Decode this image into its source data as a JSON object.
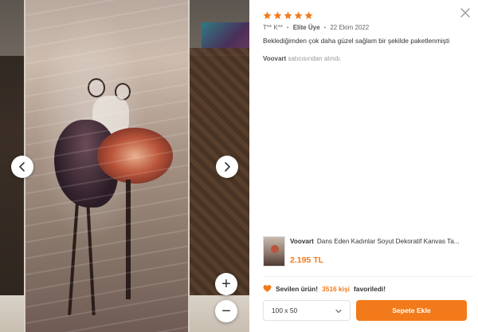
{
  "viewer": {
    "prev_icon": "chevron-left-icon",
    "next_icon": "chevron-right-icon",
    "zoom_in_label": "+",
    "zoom_out_label": "−"
  },
  "review": {
    "rating": 5,
    "rating_max": 5,
    "star_color": "#f27a1a",
    "author": "T** K**",
    "badge": "Elite Üye",
    "date": "22 Ekim 2022",
    "text": "Beklediğimden çok daha güzel sağlam bir şekilde paketlenmişti",
    "seller_name": "Voovart",
    "seller_suffix": "satıcısından alındı."
  },
  "product": {
    "brand": "Voovart",
    "title": "Dans Eden Kadınlar Soyut Dekoratif Kanvas Ta...",
    "price": "2.195 TL"
  },
  "favorite": {
    "lead": "Sevilen ürün!",
    "count": "3516 kişi",
    "tail": "favoriledi!"
  },
  "purchase": {
    "selected_variant": "100 x 50",
    "add_to_cart_label": "Sepete Ekle",
    "accent_color": "#f27a1a"
  }
}
